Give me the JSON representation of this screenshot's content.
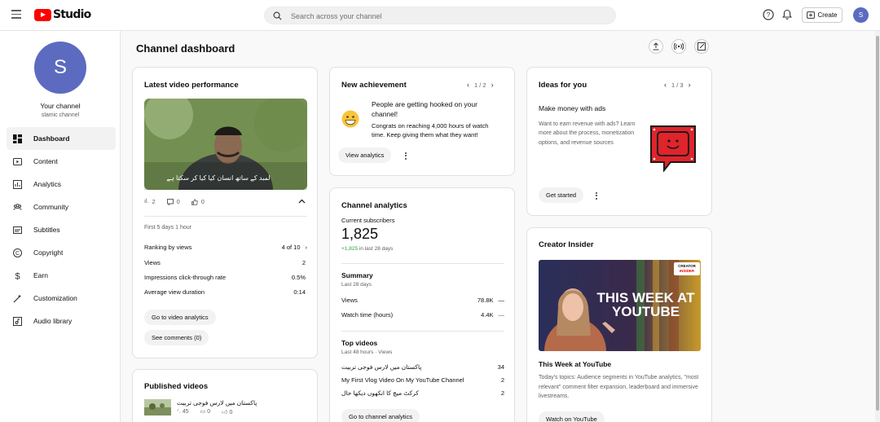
{
  "header": {
    "logo_text": "Studio",
    "search_placeholder": "Search across your channel",
    "create_label": "Create",
    "avatar_initial": "S"
  },
  "sidebar": {
    "avatar_initial": "S",
    "channel_label": "Your channel",
    "channel_name": "slamic channel",
    "items": [
      {
        "label": "Dashboard",
        "icon": "dashboard-icon"
      },
      {
        "label": "Content",
        "icon": "content-icon"
      },
      {
        "label": "Analytics",
        "icon": "analytics-icon"
      },
      {
        "label": "Community",
        "icon": "community-icon"
      },
      {
        "label": "Subtitles",
        "icon": "subtitles-icon"
      },
      {
        "label": "Copyright",
        "icon": "copyright-icon"
      },
      {
        "label": "Earn",
        "icon": "earn-icon"
      },
      {
        "label": "Customization",
        "icon": "customization-icon"
      },
      {
        "label": "Audio library",
        "icon": "audio-library-icon"
      }
    ]
  },
  "main": {
    "title": "Channel dashboard"
  },
  "latest_video": {
    "title": "Latest video performance",
    "thumbnail_caption": "لمبد کے ساتھ انسان کیا کیا کر سکتا ہے",
    "views_stat": "2",
    "comments_stat": "0",
    "likes_stat": "0",
    "period": "First 5 days 1 hour",
    "ranking_label": "Ranking by views",
    "ranking_value": "4 of 10",
    "metrics": [
      {
        "label": "Views",
        "value": "2"
      },
      {
        "label": "Impressions click-through rate",
        "value": "0.5%"
      },
      {
        "label": "Average view duration",
        "value": "0:14"
      }
    ],
    "go_analytics": "Go to video analytics",
    "see_comments": "See comments (0)"
  },
  "published": {
    "title": "Published videos",
    "item_title": "پاکستان میں لارس فوجی تربیت",
    "views": "45",
    "comments": "0",
    "likes": "0"
  },
  "achievement": {
    "title": "New achievement",
    "pager": "1 / 2",
    "headline": "People are getting hooked on your channel!",
    "body": "Congrats on reaching 4,000 hours of watch time. Keep giving them what they want!",
    "button": "View analytics"
  },
  "channel_analytics": {
    "title": "Channel analytics",
    "subs_label": "Current subscribers",
    "subs_value": "1,825",
    "subs_delta": "+1,825",
    "subs_delta_suffix": "in last 28 days",
    "summary_title": "Summary",
    "summary_period": "Last 28 days",
    "summary_rows": [
      {
        "label": "Views",
        "value": "78.8K",
        "trend": "—"
      },
      {
        "label": "Watch time (hours)",
        "value": "4.4K",
        "trend": "—"
      }
    ],
    "top_title": "Top videos",
    "top_period": "Last 48 hours · Views",
    "top_videos": [
      {
        "title": "پاکستان میں لارس فوجی تربیت",
        "views": "34"
      },
      {
        "title": "My First Vlog Video On My YouTube Channel",
        "views": "2"
      },
      {
        "title": "کرکٹ میچ کا انکھوں دیکھا حال",
        "views": "2"
      }
    ],
    "button": "Go to channel analytics"
  },
  "ideas": {
    "title": "Ideas for you",
    "pager": "1 / 3",
    "subtitle": "Make money with ads",
    "body": "Want to earn revenue with ads? Learn more about the process, monetization options, and revenue sources",
    "button": "Get started"
  },
  "creator_insider": {
    "title": "Creator Insider",
    "thumb_headline_1": "THIS WEEK AT",
    "thumb_headline_2": "YOUTUBE",
    "thumb_badge_1": "CREATOR",
    "thumb_badge_2": "INSIDER",
    "video_title": "This Week at YouTube",
    "body": "Today's topics: Audience segments in YouTube analytics, \"most relevant\" comment filter expansion, leaderboard and immersive livestreams.",
    "button": "Watch on YouTube"
  },
  "colors": {
    "brand_red": "#ff0000",
    "avatar": "#5c6bc0",
    "positive": "#2ba640"
  }
}
